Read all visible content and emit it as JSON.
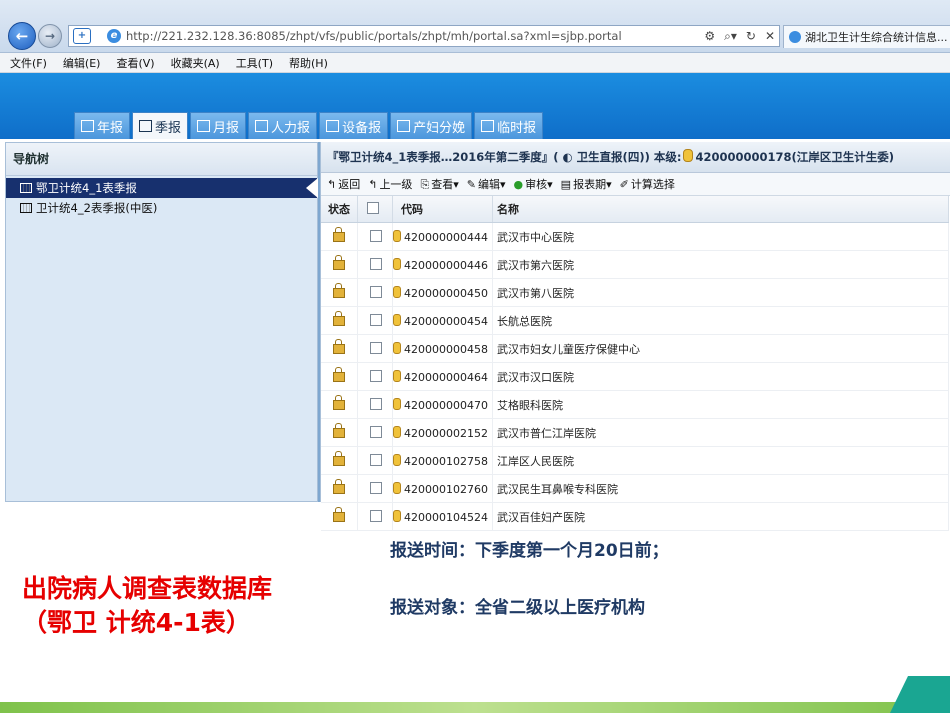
{
  "browser": {
    "url": "http://221.232.128.36:8085/zhpt/vfs/public/portals/zhpt/mh/portal.sa?xml=sjbp.portal",
    "tab_title": "湖北卫生计生综合统计信息...",
    "back_label": "←",
    "forward_label": "→"
  },
  "menu": [
    "文件(F)",
    "编辑(E)",
    "查看(V)",
    "收藏夹(A)",
    "工具(T)",
    "帮助(H)"
  ],
  "tabs": [
    {
      "label": "年报",
      "icon": "calendar-icon"
    },
    {
      "label": "季报",
      "icon": "table-icon",
      "active": true
    },
    {
      "label": "月报",
      "icon": "calendar-icon"
    },
    {
      "label": "人力报",
      "icon": "people-icon"
    },
    {
      "label": "设备报",
      "icon": "grid-icon"
    },
    {
      "label": "产妇分娩",
      "icon": "grid-icon"
    },
    {
      "label": "临时报",
      "icon": "document-icon"
    }
  ],
  "nav": {
    "header": "导航树",
    "items": [
      "鄂卫计统4_1表季报",
      "卫计统4_2表季报(中医)"
    ]
  },
  "panel": {
    "title_prefix": "『鄂卫计统4_1表季报…2016年第二季度』(",
    "title_entity": "卫生直报(四)",
    "title_level": ") 本级:",
    "title_code": "420000000178(江岸区卫生计生委)"
  },
  "toolbar": [
    "返回",
    "上一级",
    "查看▾",
    "编辑▾",
    "审核▾",
    "报表期▾",
    "计算选择"
  ],
  "table": {
    "headers": [
      "状态",
      "",
      "代码",
      "名称"
    ],
    "rows": [
      {
        "code": "420000000444",
        "name": "武汉市中心医院"
      },
      {
        "code": "420000000446",
        "name": "武汉市第六医院"
      },
      {
        "code": "420000000450",
        "name": "武汉市第八医院"
      },
      {
        "code": "420000000454",
        "name": "长航总医院"
      },
      {
        "code": "420000000458",
        "name": "武汉市妇女儿童医疗保健中心"
      },
      {
        "code": "420000000464",
        "name": "武汉市汉口医院"
      },
      {
        "code": "420000000470",
        "name": "艾格眼科医院"
      },
      {
        "code": "420000002152",
        "name": "武汉市普仁江岸医院"
      },
      {
        "code": "420000102758",
        "name": "江岸区人民医院"
      },
      {
        "code": "420000102760",
        "name": "武汉民生耳鼻喉专科医院"
      },
      {
        "code": "420000104524",
        "name": "武汉百佳妇产医院"
      }
    ]
  },
  "slide": {
    "title_line1": "出院病人调查表数据库",
    "title_line2": "（鄂卫  计统4-1表）",
    "info1": "报送时间：下季度第一个月20日前；",
    "info2": "报送对象：全省二级以上医疗机构"
  },
  "colors": {
    "header_blue": "#1b8de0",
    "title_red": "#e60000",
    "info_navy": "#1f3a64",
    "footer_green": "#7fc24b"
  }
}
